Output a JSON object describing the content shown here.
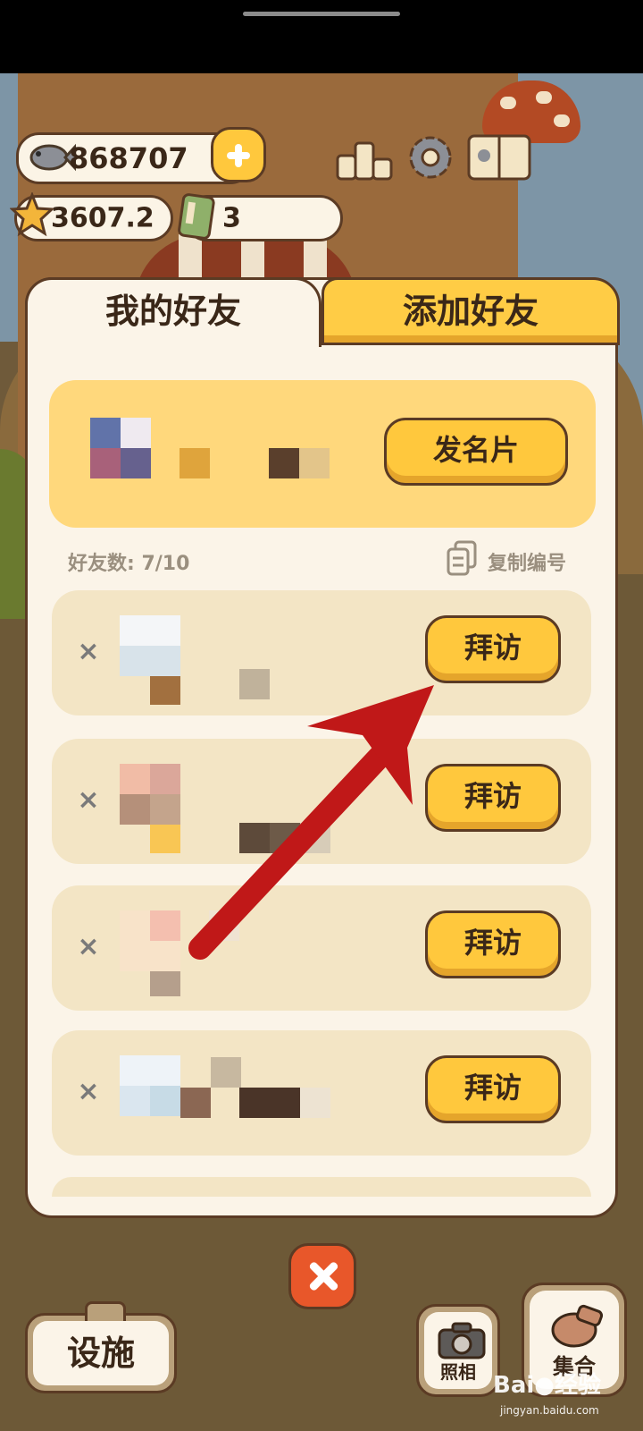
{
  "hud": {
    "fish_amount": "868707",
    "star_amount": "3607.2",
    "ticket_amount": "3",
    "icons": [
      "fish-icon",
      "add-icon",
      "star-icon",
      "ticket-icon",
      "leaderboard-icon",
      "settings-icon",
      "handbook-icon"
    ]
  },
  "tabs": {
    "my_friends": "我的好友",
    "add_friend": "添加好友"
  },
  "my_card": {
    "send_card_label": "发名片"
  },
  "friends": {
    "count_label": "好友数: 7/10",
    "copy_id_label": "复制编号",
    "visit_label": "拜访",
    "remove_symbol": "×"
  },
  "bottom_bar": {
    "facilities_label": "设施",
    "photo_label": "照相",
    "gather_label": "集合"
  },
  "watermark": {
    "brand": "Bai",
    "brand2": "经验",
    "url": "jingyan.baidu.com"
  },
  "colors": {
    "accent_yellow": "#ffc83d",
    "panel_cream": "#fbf4e8",
    "outline_brown": "#5b3b24",
    "arrow_red": "#c01818",
    "close_orange": "#e8572a"
  }
}
